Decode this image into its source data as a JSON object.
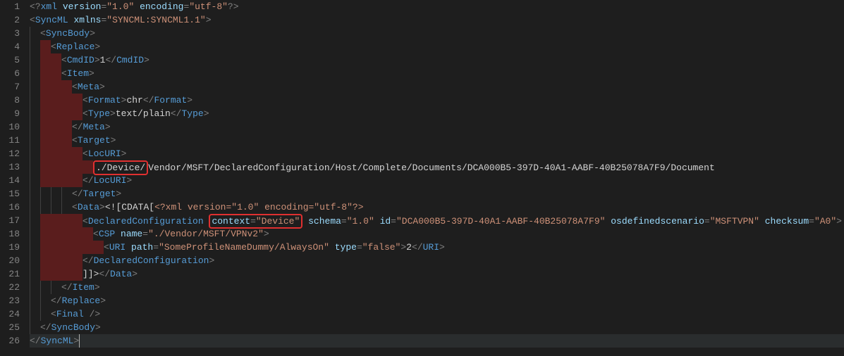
{
  "lineNumbers": [
    "1",
    "2",
    "3",
    "4",
    "5",
    "6",
    "7",
    "8",
    "9",
    "10",
    "11",
    "12",
    "13",
    "14",
    "15",
    "16",
    "17",
    "18",
    "19",
    "20",
    "21",
    "22",
    "23",
    "24",
    "25",
    "26"
  ],
  "code": {
    "l1": {
      "pi_open": "<?",
      "pi_name": "xml",
      "a1": "version",
      "v1": "\"1.0\"",
      "a2": "encoding",
      "v2": "\"utf-8\"",
      "pi_close": "?>"
    },
    "l2": {
      "open": "<",
      "tag": "SyncML",
      "a1": "xmlns",
      "v1": "\"SYNCML:SYNCML1.1\"",
      "close": ">"
    },
    "l3": {
      "open": "<",
      "tag": "SyncBody",
      "close": ">"
    },
    "l4": {
      "open": "<",
      "tag": "Replace",
      "close": ">"
    },
    "l5": {
      "open": "<",
      "tag": "CmdID",
      "close": ">",
      "txt": "1",
      "copen": "</",
      "ctag": "CmdID",
      "cclose": ">"
    },
    "l6": {
      "open": "<",
      "tag": "Item",
      "close": ">"
    },
    "l7": {
      "open": "<",
      "tag": "Meta",
      "close": ">"
    },
    "l8": {
      "open": "<",
      "tag": "Format",
      "close": ">",
      "txt": "chr",
      "copen": "</",
      "ctag": "Format",
      "cclose": ">"
    },
    "l9": {
      "open": "<",
      "tag": "Type",
      "close": ">",
      "txt": "text/plain",
      "copen": "</",
      "ctag": "Type",
      "cclose": ">"
    },
    "l10": {
      "copen": "</",
      "ctag": "Meta",
      "cclose": ">"
    },
    "l11": {
      "open": "<",
      "tag": "Target",
      "close": ">"
    },
    "l12": {
      "open": "<",
      "tag": "LocURI",
      "close": ">"
    },
    "l13": {
      "boxed": "./Device/",
      "rest": "Vendor/MSFT/DeclaredConfiguration/Host/Complete/Documents/DCA000B5-397D-40A1-AABF-40B25078A7F9/Document"
    },
    "l14": {
      "copen": "</",
      "ctag": "LocURI",
      "cclose": ">"
    },
    "l15": {
      "copen": "</",
      "ctag": "Target",
      "cclose": ">"
    },
    "l16": {
      "open": "<",
      "tag": "Data",
      "close": ">",
      "cdata": "<![CDATA[",
      "pi": "<?xml version=\"1.0\" encoding=\"utf-8\"?>"
    },
    "l17": {
      "open": "<",
      "tag": "DeclaredConfiguration",
      "box_attr": "context=\"Device\"",
      "a2": "schema",
      "v2": "\"1.0\"",
      "a3": "id",
      "v3": "\"DCA000B5-397D-40A1-AABF-40B25078A7F9\"",
      "a4": "osdefinedscenario",
      "v4": "\"MSFTVPN\"",
      "a5": "checksum",
      "v5": "\"A0\"",
      "close": ">"
    },
    "l18": {
      "open": "<",
      "tag": "CSP",
      "a1": "name",
      "v1": "\"./Vendor/MSFT/VPNv2\"",
      "close": ">"
    },
    "l19": {
      "open": "<",
      "tag": "URI",
      "a1": "path",
      "v1": "\"SomeProfileNameDummy/AlwaysOn\"",
      "a2": "type",
      "v2": "\"false\"",
      "close": ">",
      "txt": "2",
      "copen": "</",
      "ctag": "URI",
      "cclose": ">"
    },
    "l20": {
      "copen": "</",
      "ctag": "DeclaredConfiguration",
      "cclose": ">"
    },
    "l21": {
      "txt": "]]>",
      "copen": "</",
      "ctag": "Data",
      "cclose": ">"
    },
    "l22": {
      "copen": "</",
      "ctag": "Item",
      "cclose": ">"
    },
    "l23": {
      "copen": "</",
      "ctag": "Replace",
      "cclose": ">"
    },
    "l24": {
      "open": "<",
      "tag": "Final",
      "close": " />"
    },
    "l25": {
      "copen": "</",
      "ctag": "SyncBody",
      "cclose": ">"
    },
    "l26": {
      "copen": "</",
      "ctag": "SyncML",
      "cclose": ">"
    }
  },
  "highlightedLines": [
    4,
    5,
    6,
    7,
    8,
    9,
    10,
    11,
    12,
    13,
    14,
    17,
    18,
    19,
    20,
    21
  ]
}
